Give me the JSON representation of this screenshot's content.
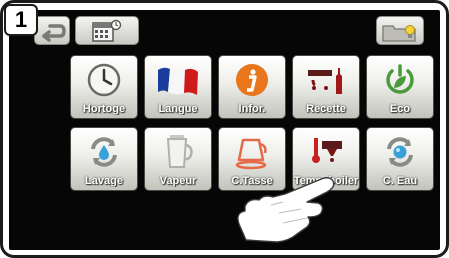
{
  "step": {
    "number": "1"
  },
  "topbar": {
    "back_icon": "back-arrow-icon",
    "calendar_icon": "calendar-icon",
    "folder_icon": "folder-lightbulb-icon"
  },
  "tiles": [
    {
      "label": "Hortoge",
      "icon": "clock-icon"
    },
    {
      "label": "Langue",
      "icon": "french-flag-icon"
    },
    {
      "label": "Infor.",
      "icon": "info-icon"
    },
    {
      "label": "Recette",
      "icon": "recipe-icon"
    },
    {
      "label": "Eco",
      "icon": "eco-power-icon"
    },
    {
      "label": "Lavage",
      "icon": "rinse-icon"
    },
    {
      "label": "Vapeur",
      "icon": "steam-jug-icon"
    },
    {
      "label": "C.Tasse",
      "icon": "cup-heater-icon"
    },
    {
      "label": "Temp. boiler",
      "icon": "temperature-icon"
    },
    {
      "label": "C. Eau",
      "icon": "water-cycle-icon"
    }
  ],
  "colors": {
    "screen_bg": "#060606",
    "orange": "#e8761c",
    "green": "#4a9a3c",
    "red": "#c82020"
  }
}
